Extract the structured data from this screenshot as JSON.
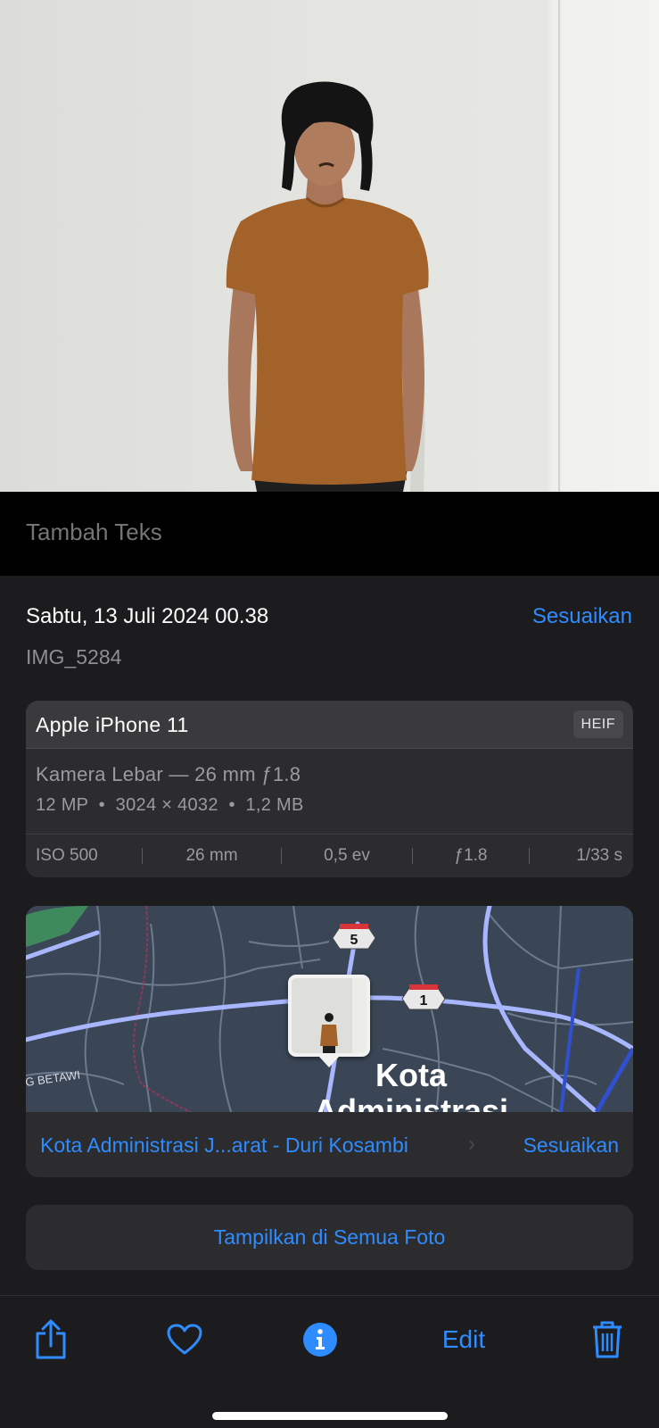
{
  "caption": {
    "placeholder": "Tambah Teks"
  },
  "info": {
    "date": "Sabtu, 13 Juli 2024 00.38",
    "adjust_label": "Sesuaikan",
    "filename": "IMG_5284"
  },
  "camera": {
    "device": "Apple iPhone 11",
    "format_badge": "HEIF",
    "lens": "Kamera Lebar — 26 mm ƒ1.8",
    "specs": "12 MP  •  3024 × 4032  •  1,2 MB",
    "exif": [
      "ISO 500",
      "26 mm",
      "0,5 ev",
      "ƒ1.8",
      "1/33 s"
    ]
  },
  "map": {
    "route_badges": [
      "5",
      "1"
    ],
    "street_label": "G BETAWI",
    "city_label_line1": "Kota",
    "city_label_line2": "Administrasi",
    "location_link": "Kota Administrasi J...arat - Duri Kosambi",
    "adjust_label": "Sesuaikan"
  },
  "show_all_label": "Tampilkan di Semua Foto",
  "toolbar": {
    "edit_label": "Edit",
    "icons": [
      "share-icon",
      "heart-icon",
      "info-icon",
      "trash-icon"
    ]
  },
  "colors": {
    "accent": "#2f8cff",
    "panel": "#1c1c1e",
    "card": "#2c2c2e",
    "map_bg": "#3a4656"
  }
}
